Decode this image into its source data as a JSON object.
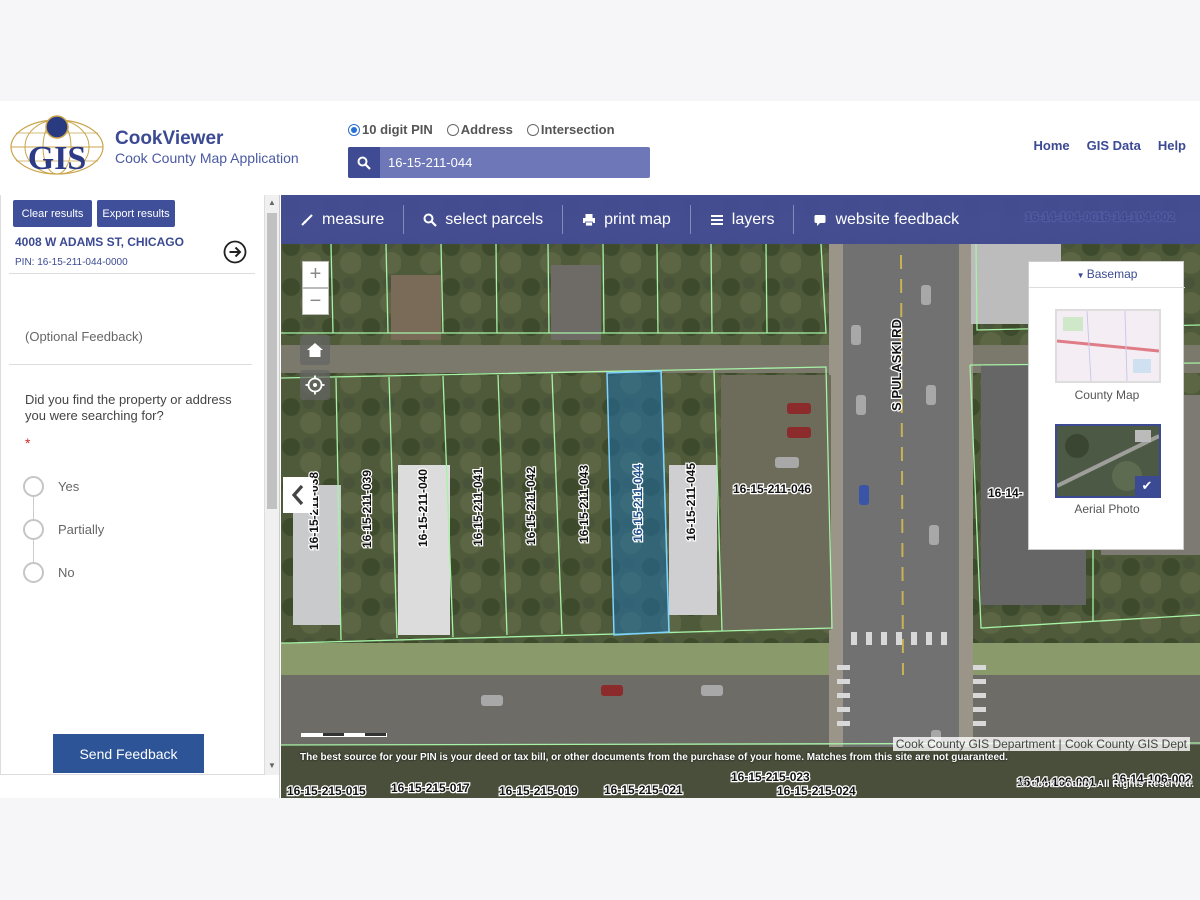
{
  "header": {
    "app_title": "CookViewer",
    "app_subtitle": "Cook County Map Application",
    "logo_text": "GIS",
    "search_types": [
      {
        "label": "10 digit PIN",
        "selected": true
      },
      {
        "label": "Address",
        "selected": false
      },
      {
        "label": "Intersection",
        "selected": false
      }
    ],
    "search_value": "16-15-211-044",
    "links": [
      "Home",
      "GIS Data",
      "Help"
    ]
  },
  "left_panel": {
    "clear_label": "Clear results",
    "export_label": "Export results",
    "result_address": "4008 W ADAMS ST, CHICAGO",
    "result_pin": "PIN: 16-15-211-044-0000",
    "optional_feedback": "(Optional Feedback)",
    "question": "Did you find the property or address you were searching for?",
    "required_mark": "*",
    "answers": [
      "Yes",
      "Partially",
      "No"
    ],
    "send_label": "Send Feedback"
  },
  "toolbar": {
    "tools": [
      {
        "label": "measure",
        "icon": "ruler-icon"
      },
      {
        "label": "select parcels",
        "icon": "search-icon"
      },
      {
        "label": "print map",
        "icon": "printer-icon"
      },
      {
        "label": "layers",
        "icon": "layers-icon"
      },
      {
        "label": "website feedback",
        "icon": "comment-icon"
      }
    ]
  },
  "map": {
    "zoom_in": "+",
    "zoom_out": "−",
    "street_label": "S PULASKI RD",
    "selected_parcel": "16-15-211-044",
    "parcel_labels": [
      "16-15-211-038",
      "16-15-211-039",
      "16-15-211-040",
      "16-15-211-041",
      "16-15-211-042",
      "16-15-211-043",
      "16-15-211-044",
      "16-15-211-045",
      "16-15-211-046",
      "16-14-"
    ],
    "top_labels": [
      "16-14-104-001",
      "16-14-104-002"
    ],
    "bottom_labels": [
      "16-15-215-015",
      "16-15-215-017",
      "16-15-215-019",
      "16-15-215-021",
      "16-15-215-023",
      "16-15-215-024",
      "16-14-106-001",
      "16-14-106-002"
    ],
    "basemap_title": "Basemap",
    "basemaps": [
      {
        "label": "County Map",
        "selected": false
      },
      {
        "label": "Aerial Photo",
        "selected": true
      }
    ],
    "attribution": "Cook County GIS Department | Cook County GIS Dept",
    "disclaimer": "The best source for your PIN is your deed or tax bill, or other documents from the purchase of your home. Matches from this site are not guaranteed.",
    "copyright": "© Cook County. All Rights Reserved.",
    "colors": {
      "toolbar": "#434c96",
      "parcel_line": "#a6f2a6",
      "selected_parcel": "#1f6fa8"
    }
  }
}
